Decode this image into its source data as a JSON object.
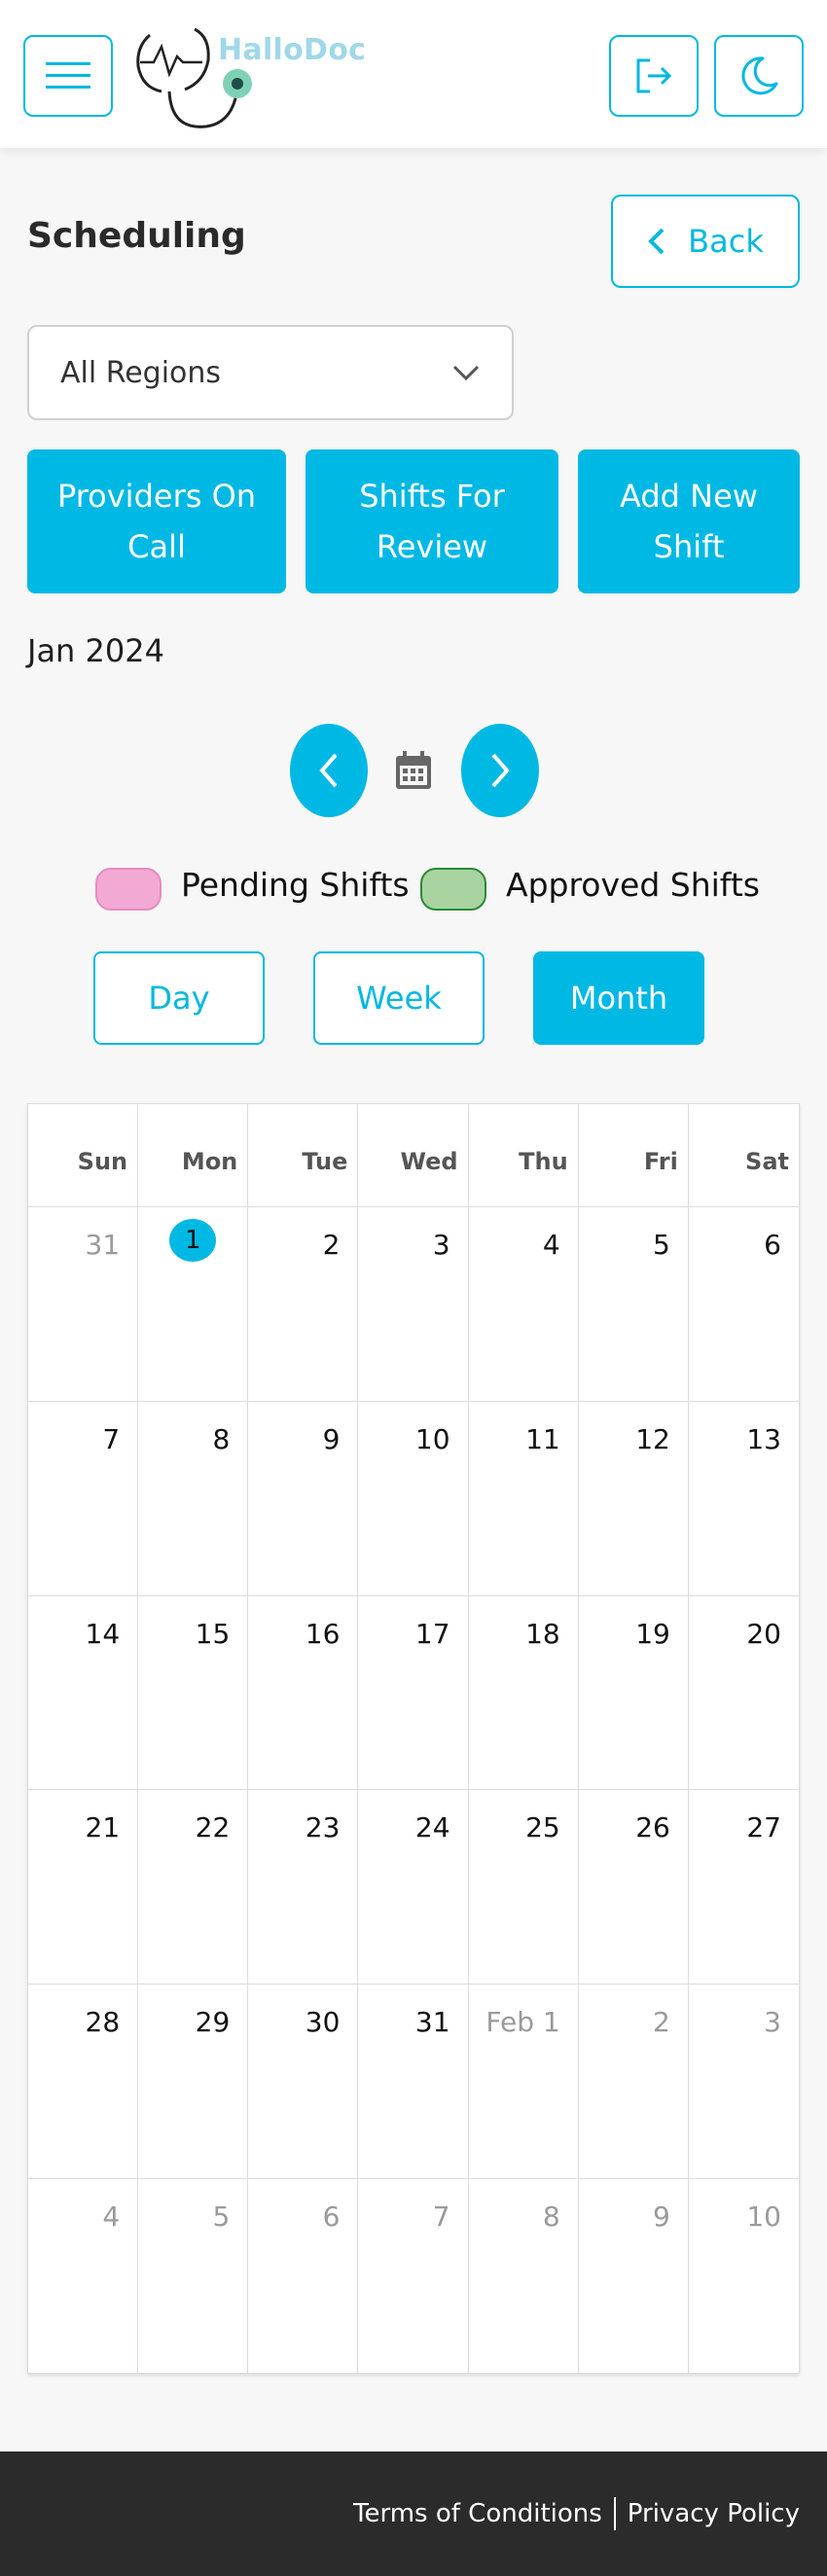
{
  "app": {
    "name": "HalloDoc"
  },
  "header": {
    "menu_icon": "hamburger-icon",
    "logout_icon": "logout-icon",
    "theme_icon": "moon-icon"
  },
  "page": {
    "title": "Scheduling",
    "back_label": "Back"
  },
  "region_select": {
    "value": "All Regions"
  },
  "actions": {
    "providers_on_call": "Providers On Call",
    "shifts_for_review": "Shifts For Review",
    "add_new_shift": "Add New Shift"
  },
  "calendar_nav": {
    "month_label": "Jan 2024"
  },
  "legend": {
    "pending": "Pending Shifts",
    "approved": "Approved Shifts",
    "pending_color": "#f2a9d4",
    "approved_color": "#a9d4a2"
  },
  "views": {
    "day": "Day",
    "week": "Week",
    "month": "Month",
    "active": "Month"
  },
  "calendar": {
    "weekdays": [
      "Sun",
      "Mon",
      "Tue",
      "Wed",
      "Thu",
      "Fri",
      "Sat"
    ],
    "days": [
      {
        "label": "31",
        "muted": true
      },
      {
        "label": "1",
        "today": true
      },
      {
        "label": "2"
      },
      {
        "label": "3"
      },
      {
        "label": "4"
      },
      {
        "label": "5"
      },
      {
        "label": "6"
      },
      {
        "label": "7"
      },
      {
        "label": "8"
      },
      {
        "label": "9"
      },
      {
        "label": "10"
      },
      {
        "label": "11"
      },
      {
        "label": "12"
      },
      {
        "label": "13"
      },
      {
        "label": "14"
      },
      {
        "label": "15"
      },
      {
        "label": "16"
      },
      {
        "label": "17"
      },
      {
        "label": "18"
      },
      {
        "label": "19"
      },
      {
        "label": "20"
      },
      {
        "label": "21"
      },
      {
        "label": "22"
      },
      {
        "label": "23"
      },
      {
        "label": "24"
      },
      {
        "label": "25"
      },
      {
        "label": "26"
      },
      {
        "label": "27"
      },
      {
        "label": "28"
      },
      {
        "label": "29"
      },
      {
        "label": "30"
      },
      {
        "label": "31"
      },
      {
        "label": "Feb 1",
        "muted": true
      },
      {
        "label": "2",
        "muted": true
      },
      {
        "label": "3",
        "muted": true
      },
      {
        "label": "4",
        "muted": true
      },
      {
        "label": "5",
        "muted": true
      },
      {
        "label": "6",
        "muted": true
      },
      {
        "label": "7",
        "muted": true
      },
      {
        "label": "8",
        "muted": true
      },
      {
        "label": "9",
        "muted": true
      },
      {
        "label": "10",
        "muted": true
      }
    ]
  },
  "footer": {
    "terms": "Terms of Conditions",
    "privacy": "Privacy Policy"
  },
  "colors": {
    "accent": "#00b8e4",
    "footer_bg": "#2b2b2b"
  }
}
